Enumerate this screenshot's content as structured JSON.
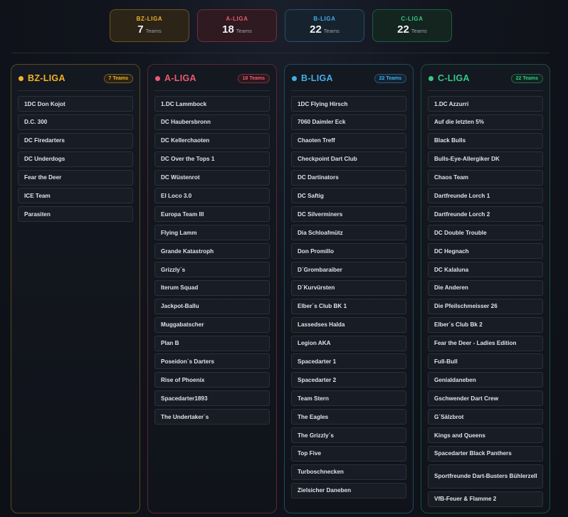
{
  "summary": [
    {
      "label": "BZ-LIGA",
      "count": "7",
      "unit": "Teams"
    },
    {
      "label": "A-LIGA",
      "count": "18",
      "unit": "Teams"
    },
    {
      "label": "B-LIGA",
      "count": "22",
      "unit": "Teams"
    },
    {
      "label": "C-LIGA",
      "count": "22",
      "unit": "Teams"
    }
  ],
  "colors": {
    "bz": "#f0b429",
    "a": "#ec5b6e",
    "b": "#43aee8",
    "c": "#34c98a"
  },
  "leagues": [
    {
      "name": "BZ-LIGA",
      "badge": "7 Teams",
      "teams": [
        "1DC Don Kojot",
        "D.C. 300",
        "DC Firedarters",
        "DC Underdogs",
        "Fear the Deer",
        "ICE Team",
        "Parasiten"
      ]
    },
    {
      "name": "A-LIGA",
      "badge": "18 Teams",
      "teams": [
        "1.DC Lammbock",
        "DC Haubersbronn",
        "DC Kellerchaoten",
        "DC Over the Tops 1",
        "DC Wüstenrot",
        "El Loco 3.0",
        "Europa Team III",
        "Flying Lamm",
        "Grande Katastroph",
        "Grizzly´s",
        "Iterum Squad",
        "Jackpot-Ballu",
        "Muggabatscher",
        "Plan B",
        "Poseidon´s Darters",
        "Rise of Phoenix",
        "Spacedarter1893",
        "The Undertaker´s"
      ]
    },
    {
      "name": "B-LIGA",
      "badge": "22 Teams",
      "teams": [
        "1DC Flying Hirsch",
        "7060 Daimler Eck",
        "Chaoten Treff",
        "Checkpoint Dart Club",
        "DC Dartinators",
        "DC Saftig",
        "DC Silverminers",
        "Dia Schloafmütz",
        "Don Promillo",
        "D´Grombaraiber",
        "D´Kurvürsten",
        "Elber´s Club BK 1",
        "Lassedses Halda",
        "Legion AKA",
        "Spacedarter 1",
        "Spacedarter 2",
        "Team Stern",
        "The Eagles",
        "The Grizzly´s",
        "Top Five",
        "Turboschnecken",
        "Zielsicher Daneben"
      ]
    },
    {
      "name": "C-LIGA",
      "badge": "22 Teams",
      "teams": [
        "1.DC Azzurri",
        "Auf die letzten 5%",
        "Black Bulls",
        "Bulls-Eye-Allergiker DK",
        "Chaos Team",
        "Dartfreunde Lorch 1",
        "Dartfreunde Lorch 2",
        "DC Double Trouble",
        "DC Hegnach",
        "DC Kalaluna",
        "Die Anderen",
        "Die Pfeilschmeisser 26",
        "Elber´s Club Bk 2",
        "Fear the Deer - Ladies Edition",
        "Full-Bull",
        "Genialdaneben",
        "Gschwender Dart Crew",
        "G´Sälzbrot",
        "Kings and Queens",
        "Spacedarter Black Panthers",
        "Sportfreunde Dart-Busters Bühlerzell",
        "VfB-Feuer & Flamme 2"
      ]
    }
  ]
}
